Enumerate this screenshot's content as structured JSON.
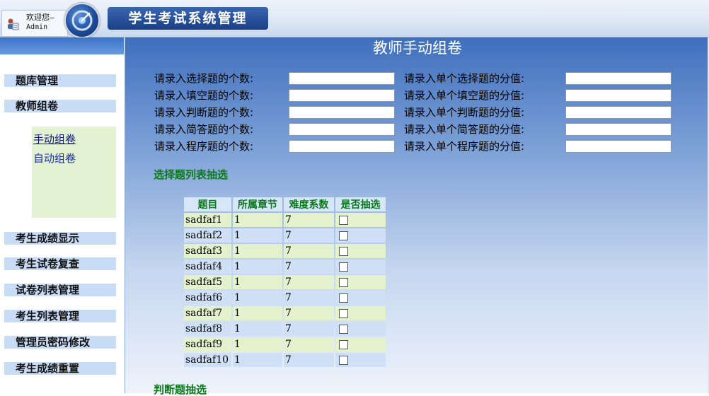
{
  "header": {
    "welcome": "欢迎您—",
    "user": "Admin",
    "app_title": "学生考试系统管理"
  },
  "sidebar": {
    "items": [
      {
        "label": "题库管理"
      },
      {
        "label": "教师组卷"
      },
      {
        "label": "考生成绩显示"
      },
      {
        "label": "考生试卷复查"
      },
      {
        "label": "试卷列表管理"
      },
      {
        "label": "考生列表管理"
      },
      {
        "label": "管理员密码修改"
      },
      {
        "label": "考生成绩重置"
      }
    ],
    "submenu": [
      {
        "label": "手动组卷"
      },
      {
        "label": "自动组卷"
      }
    ]
  },
  "main": {
    "title": "教师手动组卷",
    "form": {
      "count_labels": [
        "请录入选择题的个数:",
        "请录入填空题的个数:",
        "请录入判断题的个数:",
        "请录入简答题的个数:",
        "请录入程序题的个数:"
      ],
      "score_labels": [
        "请录入单个选择题的分值:",
        "请录入单个填空题的分值:",
        "请录入单个判断题的分值:",
        "请录入单个简答题的分值:",
        "请录入单个程序题的分值:"
      ],
      "values": [
        "",
        "",
        "",
        "",
        "",
        "",
        "",
        "",
        "",
        ""
      ]
    },
    "section_choice": "选择题列表抽选",
    "section_judge": "判断题抽选",
    "table": {
      "headers": [
        "题目",
        "所属章节",
        "难度系数",
        "是否抽选"
      ],
      "rows": [
        {
          "title": "sadfaf1",
          "chapter": "1",
          "difficulty": "7",
          "checked": false
        },
        {
          "title": "sadfaf2",
          "chapter": "1",
          "difficulty": "7",
          "checked": false
        },
        {
          "title": "sadfaf3",
          "chapter": "1",
          "difficulty": "7",
          "checked": false
        },
        {
          "title": "sadfaf4",
          "chapter": "1",
          "difficulty": "7",
          "checked": false
        },
        {
          "title": "sadfaf5",
          "chapter": "1",
          "difficulty": "7",
          "checked": false
        },
        {
          "title": "sadfaf6",
          "chapter": "1",
          "difficulty": "7",
          "checked": false
        },
        {
          "title": "sadfaf7",
          "chapter": "1",
          "difficulty": "7",
          "checked": false
        },
        {
          "title": "sadfaf8",
          "chapter": "1",
          "difficulty": "7",
          "checked": false
        },
        {
          "title": "sadfaf9",
          "chapter": "1",
          "difficulty": "7",
          "checked": false
        },
        {
          "title": "sadfaf10",
          "chapter": "1",
          "difficulty": "7",
          "checked": false
        }
      ]
    }
  },
  "colors": {
    "accent": "#1b3f85",
    "section_green": "#0b7a1a",
    "link_blue": "#1a2fb0"
  }
}
